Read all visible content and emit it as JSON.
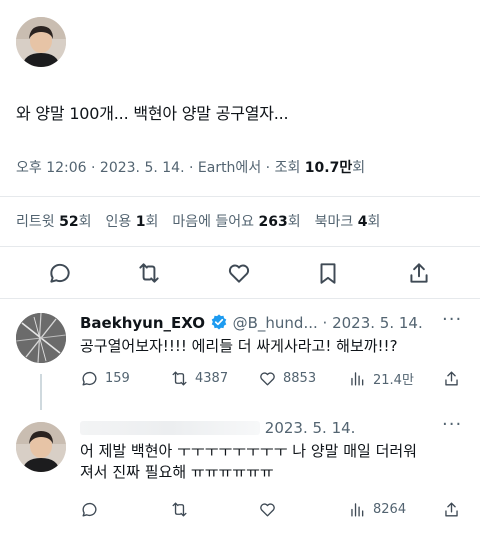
{
  "tweet": {
    "text": "와 양말 100개... 백현아 양말 공구열자...",
    "time": "오후 12:06",
    "date": "2023. 5. 14.",
    "source": "Earth에서",
    "views_label": "조회",
    "views_value": "10.7만",
    "views_suffix": "회",
    "stats": [
      {
        "label": "리트윗",
        "value": "52",
        "suffix": "회"
      },
      {
        "label": "인용",
        "value": "1",
        "suffix": "회"
      },
      {
        "label": "마음에 들어요",
        "value": "263",
        "suffix": "회"
      },
      {
        "label": "북마크",
        "value": "4",
        "suffix": "회"
      }
    ],
    "actions": [
      "reply-icon",
      "retweet-icon",
      "heart-icon",
      "bookmark-icon",
      "share-icon"
    ]
  },
  "replies": [
    {
      "name": "Baekhyun_EXO",
      "verified": true,
      "handle": "@B_hund...",
      "date": "· 2023. 5. 14.",
      "more": "···",
      "text": "공구열어보자!!!! 에리들 더 싸게사라고! 해보까!!?",
      "replies": "159",
      "retweets": "4387",
      "likes": "8853",
      "views": "21.4만"
    },
    {
      "date": "2023. 5. 14.",
      "more": "···",
      "text_line1": "어 제발 백현아 ㅜㅜㅜㅜㅜㅜㅜㅜ 나 양말 매일 더러워",
      "text_line2": "져서 진짜 필요해 ㅠㅠㅠㅠㅠㅠ",
      "replies": "",
      "retweets": "",
      "likes": "",
      "views": "8264"
    }
  ],
  "colors": {
    "text": "#0f1419",
    "muted": "#536471",
    "verified": "#1d9bf0",
    "divider": "#e6e9ec"
  }
}
